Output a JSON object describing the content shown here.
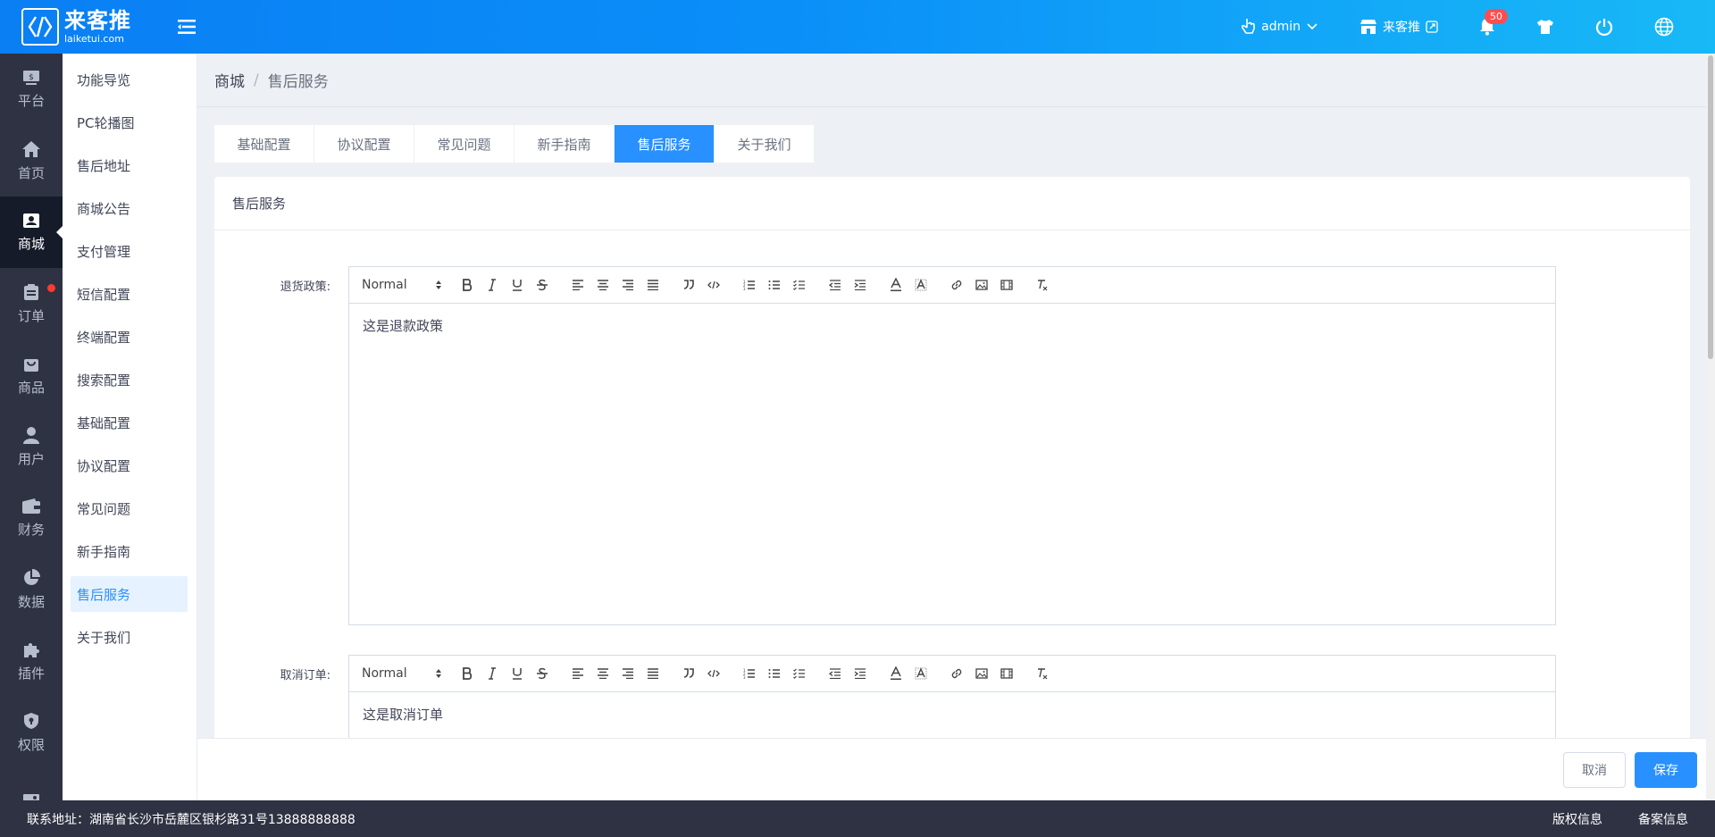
{
  "brand": {
    "name_cn": "来客推",
    "name_en": "laiketui.com"
  },
  "header": {
    "user": "admin",
    "store": "来客推",
    "notification_count": "50"
  },
  "leftnav": [
    {
      "label": "平台",
      "icon": "platform-icon"
    },
    {
      "label": "首页",
      "icon": "home-icon"
    },
    {
      "label": "商城",
      "icon": "store-icon"
    },
    {
      "label": "订单",
      "icon": "clipboard-icon"
    },
    {
      "label": "商品",
      "icon": "bag-icon"
    },
    {
      "label": "用户",
      "icon": "user-icon"
    },
    {
      "label": "财务",
      "icon": "wallet-icon"
    },
    {
      "label": "数据",
      "icon": "pie-chart-icon"
    },
    {
      "label": "插件",
      "icon": "puzzle-icon"
    },
    {
      "label": "权限",
      "icon": "shield-icon"
    },
    {
      "label": "",
      "icon": "image-icon"
    }
  ],
  "submenu": [
    "功能导览",
    "PC轮播图",
    "售后地址",
    "商城公告",
    "支付管理",
    "短信配置",
    "终端配置",
    "搜索配置",
    "基础配置",
    "协议配置",
    "常见问题",
    "新手指南",
    "售后服务",
    "关于我们"
  ],
  "breadcrumb": {
    "root": "商城",
    "current": "售后服务"
  },
  "tabs": [
    "基础配置",
    "协议配置",
    "常见问题",
    "新手指南",
    "售后服务",
    "关于我们"
  ],
  "panel": {
    "title": "售后服务",
    "fields": [
      {
        "label": "退货政策:",
        "content": "这是退款政策",
        "format": "Normal"
      },
      {
        "label": "取消订单:",
        "content": "这是取消订单",
        "format": "Normal"
      }
    ]
  },
  "actions": {
    "cancel": "取消",
    "save": "保存"
  },
  "footer": {
    "address": "联系地址：湖南省长沙市岳麓区银杉路31号13888888888",
    "copyright": "版权信息",
    "record": "备案信息"
  },
  "colors": {
    "primary": "#2890ff",
    "nav_bg": "#2e3242",
    "badge": "#ff4d4f"
  }
}
